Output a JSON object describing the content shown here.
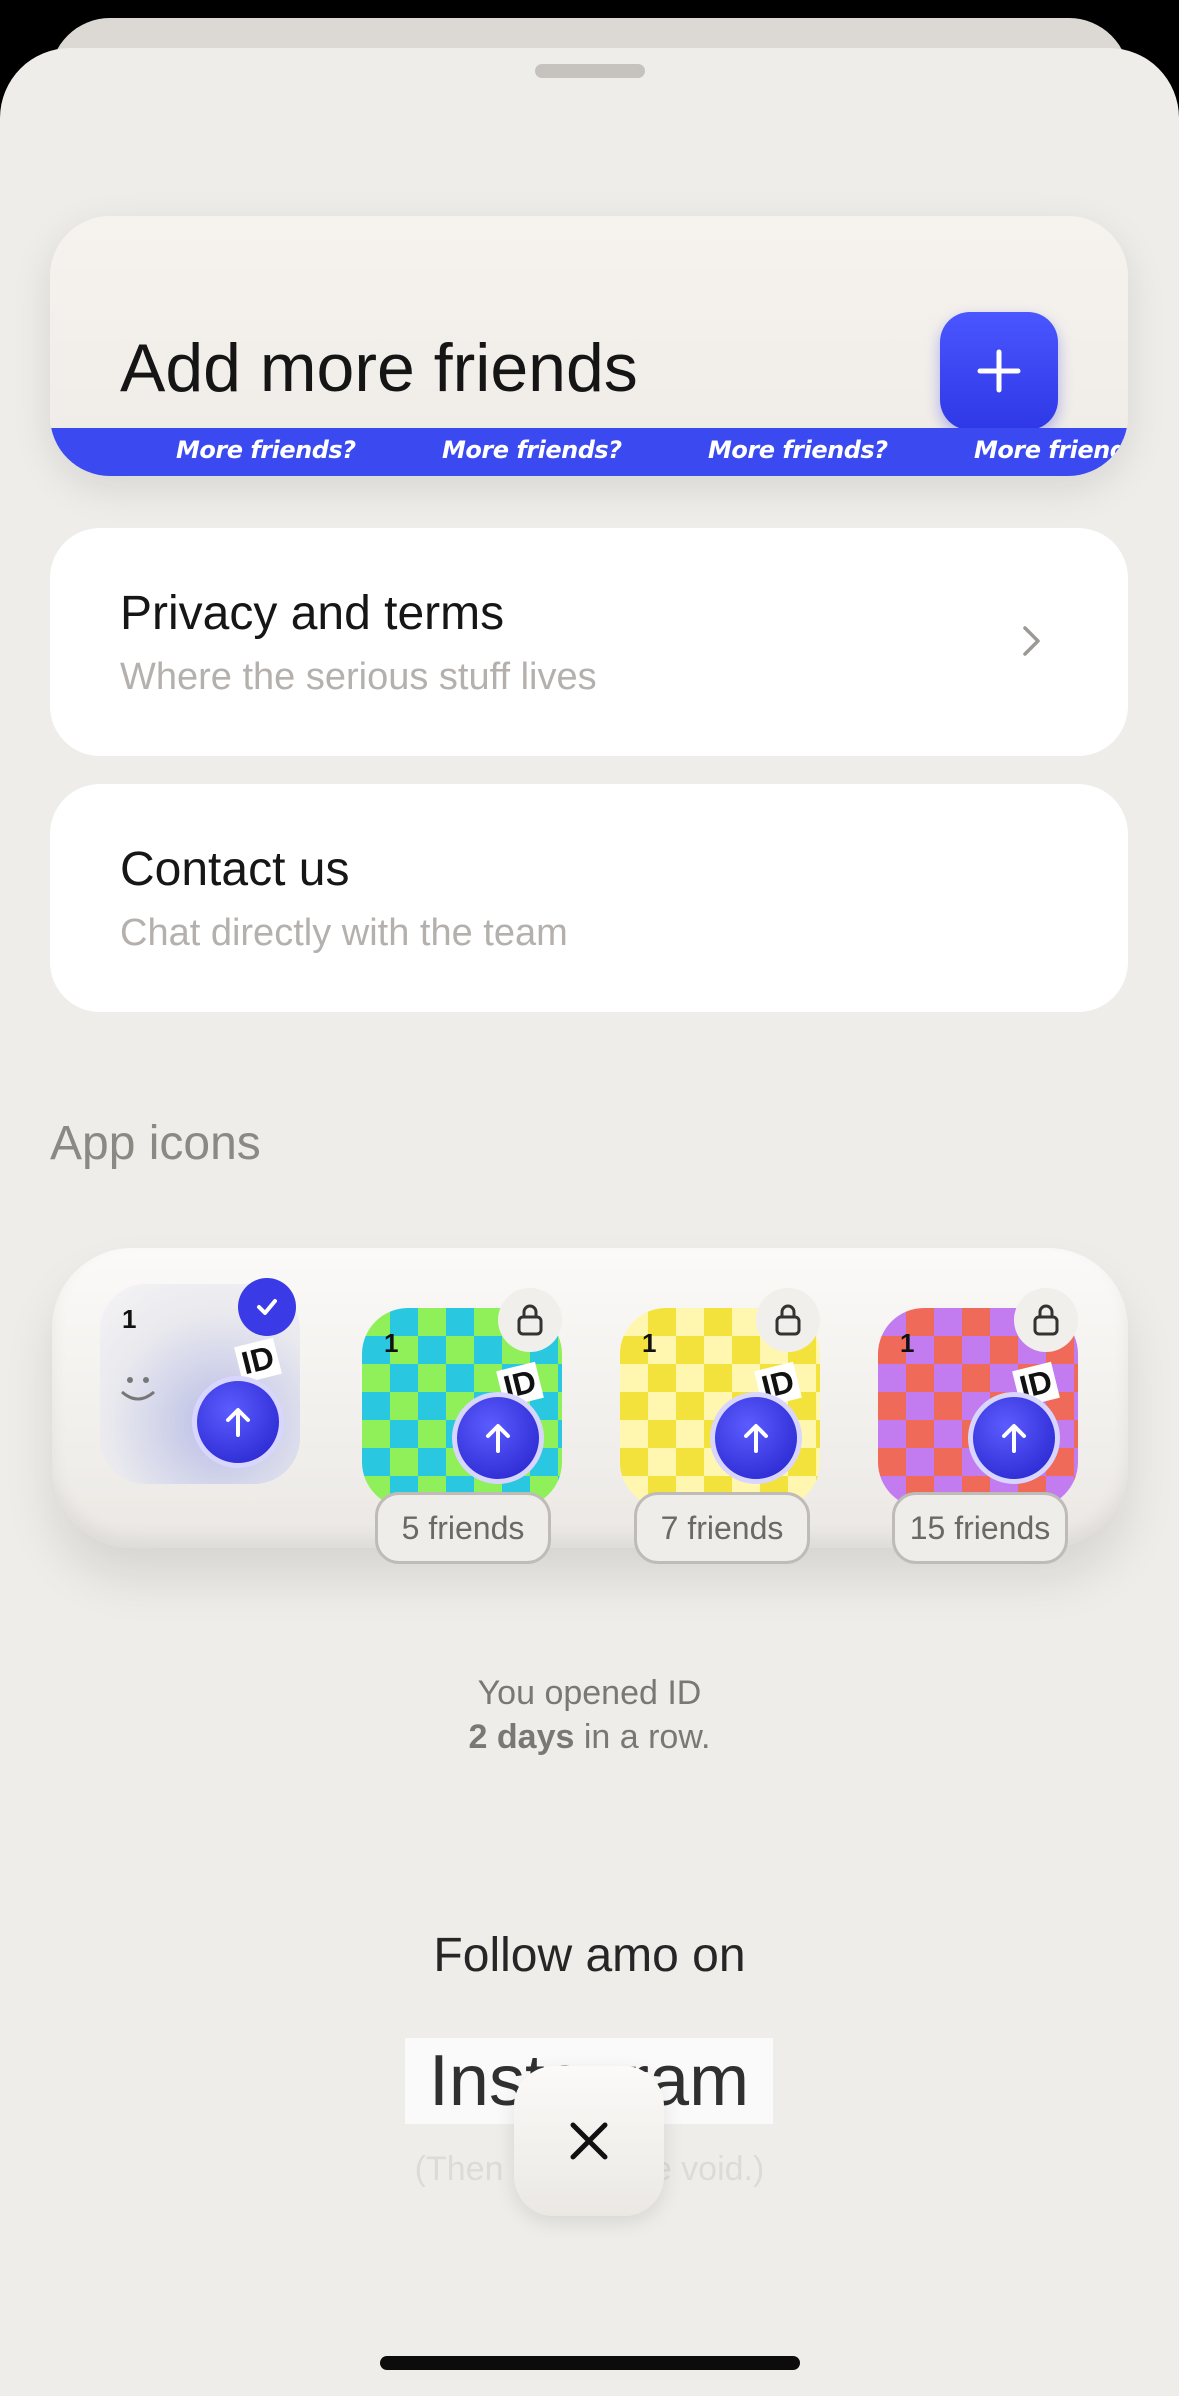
{
  "add_friends": {
    "title": "Add more friends",
    "ticker_text": "More friends?",
    "ticker_repeats": [
      "More friends?",
      "More friends?",
      "More friends?",
      "More friends?"
    ],
    "accent": "#3a4af0"
  },
  "menu": [
    {
      "title": "Privacy and terms",
      "subtitle": "Where the serious stuff lives"
    },
    {
      "title": "Contact us",
      "subtitle": "Chat directly with the team"
    }
  ],
  "app_icons": {
    "section_title": "App icons",
    "icons": [
      {
        "name": "default",
        "selected": true,
        "number": "1",
        "badge": "ID"
      },
      {
        "name": "green-checker",
        "locked": true,
        "number": "1",
        "badge": "ID",
        "requirement": "5 friends"
      },
      {
        "name": "yellow-checker",
        "locked": true,
        "number": "1",
        "badge": "ID",
        "requirement": "7 friends"
      },
      {
        "name": "pink-checker",
        "locked": true,
        "number": "1",
        "badge": "ID",
        "requirement": "15 friends"
      }
    ]
  },
  "streak": {
    "line1": "You opened ID",
    "days": "2 days",
    "line2_suffix": " in a row."
  },
  "social": {
    "follow_text": "Follow amo on",
    "link_text": "Instagram",
    "footnote": "(Then go into the void.)"
  }
}
